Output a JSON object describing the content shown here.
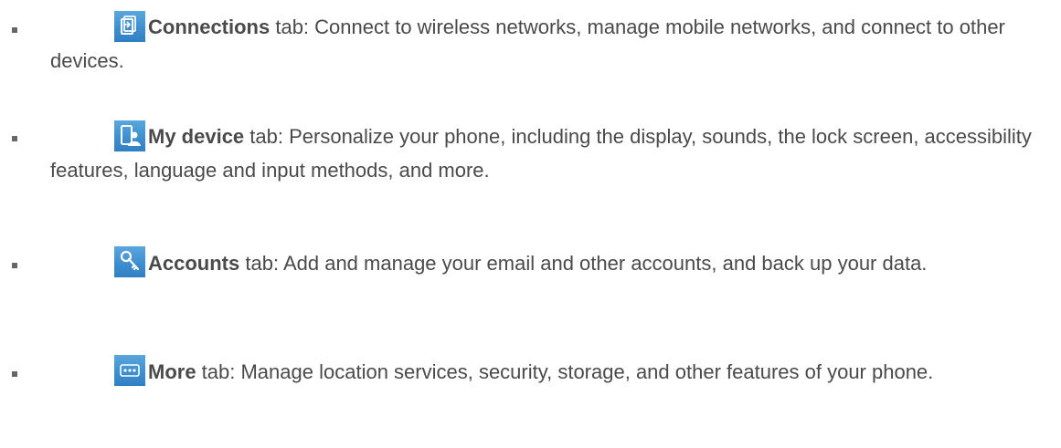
{
  "items": [
    {
      "icon": "connections-icon",
      "name": "Connections",
      "suffix": " tab: Connect to wireless networks, manage mobile networks, and connect to other devices."
    },
    {
      "icon": "my-device-icon",
      "name": "My device",
      "suffix": " tab: Personalize your phone, including the display, sounds, the lock screen, accessibility features, language and input methods, and more."
    },
    {
      "icon": "accounts-key-icon",
      "name": "Accounts",
      "suffix": " tab: Add and manage your email and other accounts, and back up your data."
    },
    {
      "icon": "more-dots-icon",
      "name": "More",
      "suffix": " tab: Manage location services, security, storage, and other features of your phone."
    }
  ],
  "colors": {
    "text": "#4a4a4a",
    "bullet": "#666666",
    "icon_blue": "#3f8fcf"
  }
}
